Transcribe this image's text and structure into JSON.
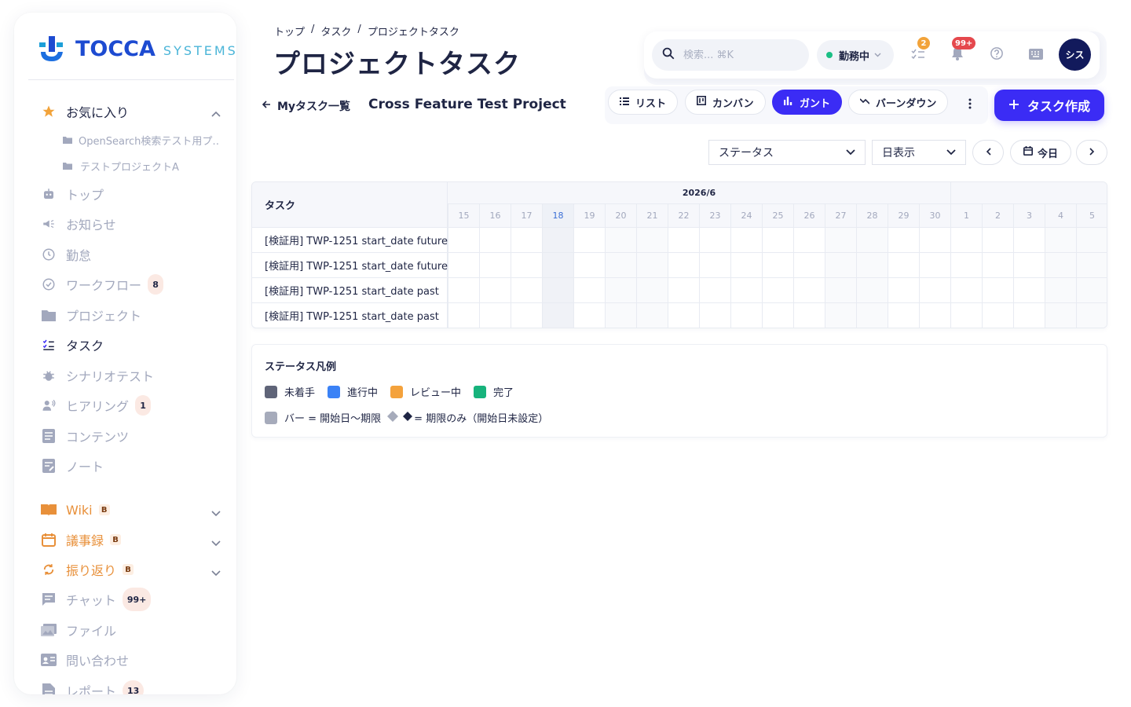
{
  "brand": {
    "name": "TOCCA",
    "sub": "SYSTEMS"
  },
  "sidebar": {
    "favorites": {
      "label": "お気に入り",
      "items": [
        "OpenSearch検索テスト用プ…",
        "テストプロジェクトA"
      ]
    },
    "items": [
      {
        "label": "トップ",
        "icon": "robot-icon"
      },
      {
        "label": "お知らせ",
        "icon": "megaphone-icon"
      },
      {
        "label": "勤怠",
        "icon": "clock-icon"
      },
      {
        "label": "ワークフロー",
        "icon": "check-circle-icon",
        "count": "8"
      },
      {
        "label": "プロジェクト",
        "icon": "folder-icon"
      },
      {
        "label": "タスク",
        "icon": "task-list-icon"
      },
      {
        "label": "シナリオテスト",
        "icon": "bug-icon"
      },
      {
        "label": "ヒアリング",
        "icon": "hearing-icon",
        "count": "1"
      },
      {
        "label": "コンテンツ",
        "icon": "article-icon"
      },
      {
        "label": "ノート",
        "icon": "note-icon"
      },
      {
        "label": "Wiki",
        "icon": "book-icon",
        "beta": "B"
      },
      {
        "label": "議事録",
        "icon": "calendar-icon",
        "beta": "B"
      },
      {
        "label": "振り返り",
        "icon": "refresh-icon",
        "beta": "B"
      },
      {
        "label": "チャット",
        "icon": "chat-icon",
        "count": "99+"
      },
      {
        "label": "ファイル",
        "icon": "images-icon"
      },
      {
        "label": "問い合わせ",
        "icon": "contact-card-icon"
      },
      {
        "label": "レポート",
        "icon": "report-icon",
        "count": "13"
      }
    ]
  },
  "header": {
    "breadcrumb": [
      "トップ",
      "タスク",
      "プロジェクトタスク"
    ],
    "breadcrumb_sep": "/",
    "title": "プロジェクトタスク",
    "search_placeholder": "検索... ⌘K",
    "status": "勤務中",
    "tasks_badge": "2",
    "notifications_badge": "99+",
    "avatar": "シス"
  },
  "subheader": {
    "back": "Myタスク一覧",
    "project": "Cross Feature Test Project",
    "views": [
      "リスト",
      "カンバン",
      "ガント",
      "バーンダウン"
    ],
    "active_view": "ガント",
    "create": "タスク作成"
  },
  "filters": {
    "status": "ステータス",
    "scale": "日表示",
    "today": "今日"
  },
  "gantt": {
    "task_header": "タスク",
    "months": [
      {
        "label": "2026/6"
      },
      {
        "label": ""
      }
    ],
    "days": [
      "15",
      "16",
      "17",
      "18",
      "19",
      "20",
      "21",
      "22",
      "23",
      "24",
      "25",
      "26",
      "27",
      "28",
      "29",
      "30",
      "1",
      "2",
      "3",
      "4",
      "5"
    ],
    "today": "18",
    "tasks": [
      "[検証用] TWP-1251 start_date future",
      "[検証用] TWP-1251 start_date future",
      "[検証用] TWP-1251 start_date past",
      "[検証用] TWP-1251 start_date past"
    ]
  },
  "legend": {
    "title": "ステータス凡例",
    "statuses": [
      {
        "label": "未着手",
        "color": "#5f6478"
      },
      {
        "label": "進行中",
        "color": "#3b82f6"
      },
      {
        "label": "レビュー中",
        "color": "#f4a23c"
      },
      {
        "label": "完了",
        "color": "#17b37c"
      }
    ],
    "bar_note": "バー = 開始日〜期限",
    "diamond_note": "= 期限のみ（開始日未設定）",
    "bar_color": "#a6abbb"
  }
}
